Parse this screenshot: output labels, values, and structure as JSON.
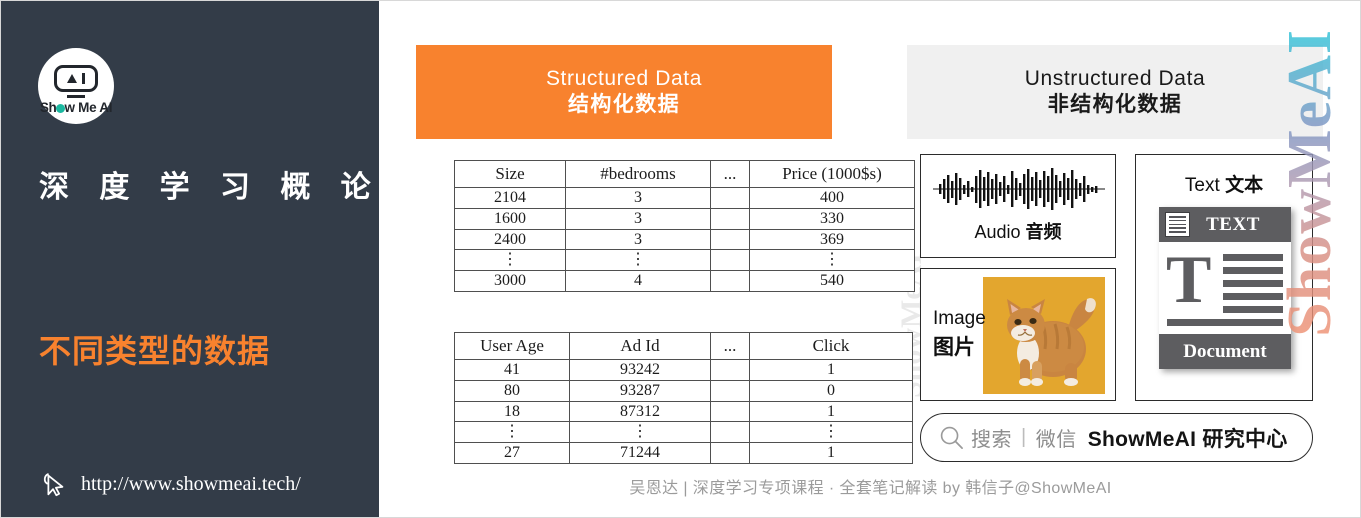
{
  "sidebar": {
    "logo": {
      "icon": "showmeai-robot-logo",
      "wordmark_pre": "Sh",
      "wordmark_post": "w Me AI"
    },
    "title": "深 度 学 习 概 论",
    "subtitle": "不同类型的数据",
    "url": "http://www.showmeai.tech/",
    "cursor_icon": "cursor-pointer-icon",
    "background_color": "#333C48",
    "accent_color": "#F8822E"
  },
  "watermarks": {
    "right": "ShowMeAI",
    "left": "ShowMeAI"
  },
  "structured": {
    "header_en": "Structured Data",
    "header_zh": "结构化数据",
    "header_bg": "#F8822E",
    "tables": [
      {
        "name": "housing-table",
        "columns": [
          "Size",
          "#bedrooms",
          "...",
          "Price (1000$s)"
        ],
        "rows": [
          [
            "2104",
            "3",
            "",
            "400"
          ],
          [
            "1600",
            "3",
            "",
            "330"
          ],
          [
            "2400",
            "3",
            "",
            "369"
          ],
          [
            "⋮",
            "⋮",
            "",
            "⋮"
          ],
          [
            "3000",
            "4",
            "",
            "540"
          ]
        ]
      },
      {
        "name": "ads-table",
        "columns": [
          "User Age",
          "Ad Id",
          "...",
          "Click"
        ],
        "rows": [
          [
            "41",
            "93242",
            "",
            "1"
          ],
          [
            "80",
            "93287",
            "",
            "0"
          ],
          [
            "18",
            "87312",
            "",
            "1"
          ],
          [
            "⋮",
            "⋮",
            "",
            "⋮"
          ],
          [
            "27",
            "71244",
            "",
            "1"
          ]
        ]
      }
    ]
  },
  "unstructured": {
    "header_en": "Unstructured Data",
    "header_zh": "非结构化数据",
    "header_bg": "#F0F0F0",
    "cards": {
      "audio": {
        "label_en": "Audio",
        "label_zh": "音频",
        "icon": "audio-waveform-icon"
      },
      "image": {
        "label_en": "Image",
        "label_zh": "图片",
        "icon": "cat-photo"
      },
      "text": {
        "label_en": "Text",
        "label_zh": "文本",
        "doc_head": "TEXT",
        "doc_letter": "T",
        "doc_foot": "Document"
      }
    }
  },
  "search_bar": {
    "icon": "search-magnifier-icon",
    "hint": "搜索",
    "separator": "|",
    "channel": "微信",
    "brand": "ShowMeAI 研究中心"
  },
  "footer": {
    "text": "吴恩达 | 深度学习专项课程 · 全套笔记解读  by 韩信子@ShowMeAI"
  }
}
